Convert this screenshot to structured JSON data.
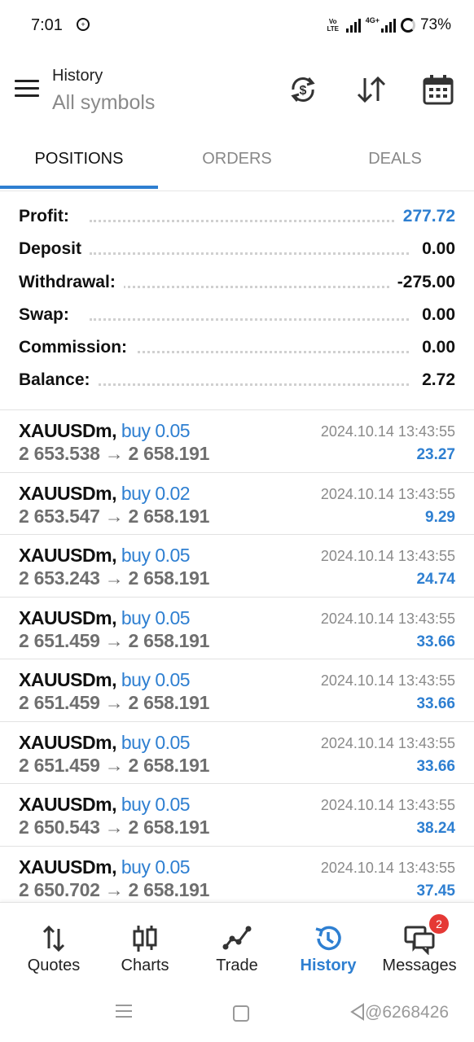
{
  "status_bar": {
    "time": "7:01",
    "network_label": "Vo LTE",
    "net_type": "4G+",
    "battery": "73%"
  },
  "header": {
    "title": "History",
    "subtitle": "All symbols",
    "icons": [
      "currency-exchange-icon",
      "sort-icon",
      "calendar-icon"
    ]
  },
  "tabs": [
    {
      "label": "POSITIONS",
      "active": true
    },
    {
      "label": "ORDERS",
      "active": false
    },
    {
      "label": "DEALS",
      "active": false
    }
  ],
  "summary": [
    {
      "label": "Profit:",
      "value": "277.72",
      "highlight": true
    },
    {
      "label": "Deposit",
      "value": "0.00",
      "highlight": false
    },
    {
      "label": "Withdrawal:",
      "value": "-275.00",
      "highlight": false
    },
    {
      "label": "Swap:",
      "value": "0.00",
      "highlight": false
    },
    {
      "label": "Commission:",
      "value": "0.00",
      "highlight": false
    },
    {
      "label": "Balance:",
      "value": "2.72",
      "highlight": false
    }
  ],
  "positions": [
    {
      "symbol": "XAUUSDm,",
      "type": "buy 0.05",
      "open": "2 653.538",
      "arrow": "→",
      "close": "2 658.191",
      "time": "2024.10.14 13:43:55",
      "profit": "23.27"
    },
    {
      "symbol": "XAUUSDm,",
      "type": "buy 0.02",
      "open": "2 653.547",
      "arrow": "→",
      "close": "2 658.191",
      "time": "2024.10.14 13:43:55",
      "profit": "9.29"
    },
    {
      "symbol": "XAUUSDm,",
      "type": "buy 0.05",
      "open": "2 653.243",
      "arrow": "→",
      "close": "2 658.191",
      "time": "2024.10.14 13:43:55",
      "profit": "24.74"
    },
    {
      "symbol": "XAUUSDm,",
      "type": "buy 0.05",
      "open": "2 651.459",
      "arrow": "→",
      "close": "2 658.191",
      "time": "2024.10.14 13:43:55",
      "profit": "33.66"
    },
    {
      "symbol": "XAUUSDm,",
      "type": "buy 0.05",
      "open": "2 651.459",
      "arrow": "→",
      "close": "2 658.191",
      "time": "2024.10.14 13:43:55",
      "profit": "33.66"
    },
    {
      "symbol": "XAUUSDm,",
      "type": "buy 0.05",
      "open": "2 651.459",
      "arrow": "→",
      "close": "2 658.191",
      "time": "2024.10.14 13:43:55",
      "profit": "33.66"
    },
    {
      "symbol": "XAUUSDm,",
      "type": "buy 0.05",
      "open": "2 650.543",
      "arrow": "→",
      "close": "2 658.191",
      "time": "2024.10.14 13:43:55",
      "profit": "38.24"
    },
    {
      "symbol": "XAUUSDm,",
      "type": "buy 0.05",
      "open": "2 650.702",
      "arrow": "→",
      "close": "2 658.191",
      "time": "2024.10.14 13:43:55",
      "profit": "37.45"
    }
  ],
  "bottom_nav": [
    {
      "label": "Quotes",
      "icon": "quotes-icon",
      "active": false
    },
    {
      "label": "Charts",
      "icon": "charts-icon",
      "active": false
    },
    {
      "label": "Trade",
      "icon": "trade-icon",
      "active": false
    },
    {
      "label": "History",
      "icon": "history-icon",
      "active": true
    },
    {
      "label": "Messages",
      "icon": "messages-icon",
      "active": false,
      "badge": "2"
    }
  ],
  "watermark": "@6268426",
  "colors": {
    "accent": "#2e7fd1",
    "badge": "#e53935",
    "muted": "#8a8a8a"
  }
}
